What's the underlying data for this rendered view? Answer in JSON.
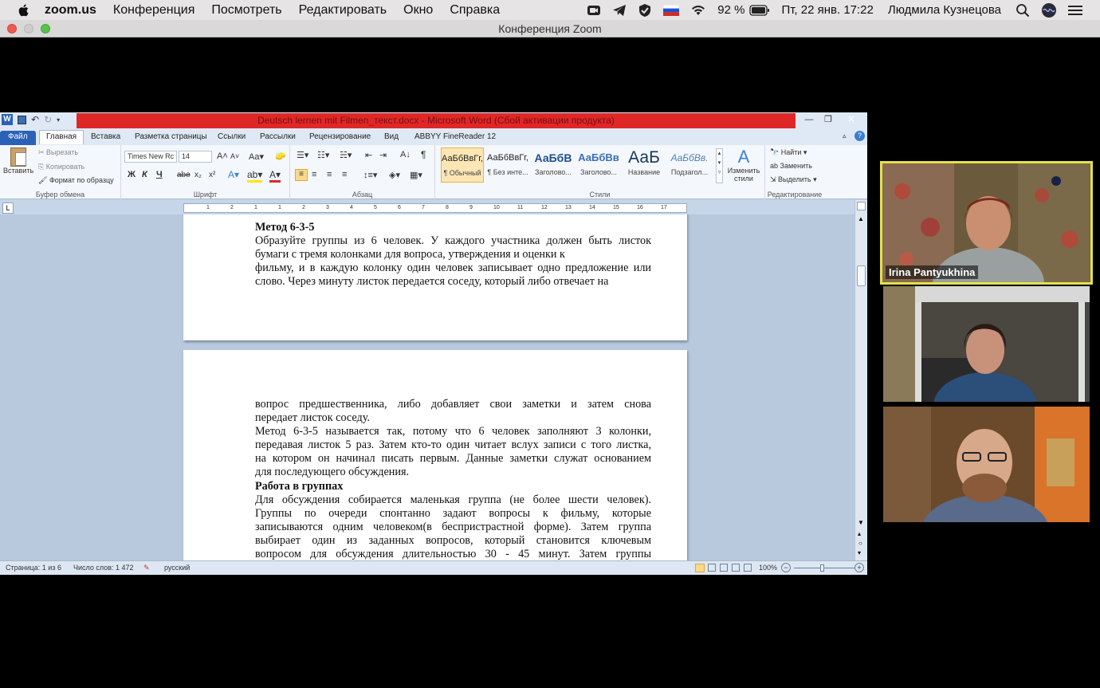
{
  "menubar": {
    "app": "zoom.us",
    "items": [
      "Конференция",
      "Посмотреть",
      "Редактировать",
      "Окно",
      "Справка"
    ],
    "battery": "92 %",
    "datetime": "Пт, 22 янв.  17:22",
    "user": "Людмила Кузнецова"
  },
  "zoom": {
    "window_title": "Конференция Zoom"
  },
  "word": {
    "title": "Deutsch lernen mit Filmen_текст.docx  -  Microsoft Word (Сбой активации продукта)",
    "tabs": [
      "Файл",
      "Главная",
      "Вставка",
      "Разметка страницы",
      "Ссылки",
      "Рассылки",
      "Рецензирование",
      "Вид",
      "ABBYY FineReader 12"
    ],
    "clipboard": {
      "paste": "Вставить",
      "cut": "Вырезать",
      "copy": "Копировать",
      "format_painter": "Формат по образцу",
      "label": "Буфер обмена"
    },
    "font": {
      "name": "Times New Rc",
      "size": "14",
      "bold": "Ж",
      "italic": "К",
      "underline": "Ч",
      "strike": "abe",
      "subscript": "x₂",
      "superscript": "x²",
      "label": "Шрифт"
    },
    "paragraph": {
      "label": "Абзац"
    },
    "styles": {
      "items": [
        {
          "preview": "АаБбВвГг,",
          "name": "¶ Обычный"
        },
        {
          "preview": "АаБбВвГг,",
          "name": "¶ Без инте..."
        },
        {
          "preview": "АаБбВ",
          "name": "Заголово..."
        },
        {
          "preview": "АаБбВв",
          "name": "Заголово..."
        },
        {
          "preview": "АаБ",
          "name": "Название"
        },
        {
          "preview": "АаБбВв.",
          "name": "Подзагол..."
        }
      ],
      "change": "Изменить стили",
      "label": "Стили"
    },
    "editing": {
      "find": "Найти",
      "replace": "Заменить",
      "select": "Выделить",
      "label": "Редактирование"
    },
    "ruler_numbers": [
      "1",
      "2",
      "1",
      "1",
      "2",
      "3",
      "4",
      "5",
      "6",
      "7",
      "8",
      "9",
      "10",
      "11",
      "12",
      "13",
      "14",
      "15",
      "16",
      "17"
    ],
    "page1": {
      "heading": "Метод 6-3-5",
      "lines": [
        "Образуйте группы из 6 человек. У каждого участника должен быть листок",
        "бумаги с тремя колонками для вопроса, утверждения и оценки к",
        "фильму, и в каждую колонку один человек записывает одно предложение или",
        "слово. Через минуту листок передается соседу, который либо отвечает на"
      ]
    },
    "page2": {
      "lines_a": [
        "вопрос предшественника, либо добавляет свои заметки и затем снова",
        "передает листок соседу.",
        "Метод 6-3-5 называется так, потому что 6 человек заполняют 3 колонки,",
        "передавая листок 5 раз. Затем кто-то один читает вслух записи с того листка,",
        "на котором он начинал писать первым. Данные заметки служат основанием",
        "для последующего обсуждения."
      ],
      "heading": "Работа в группах",
      "lines_b": [
        "Для обсуждения собирается маленькая группа (не более шести человек).",
        "Группы по очереди спонтанно задают вопросы к фильму, которые",
        "записываются одним человеком(в беспристрастной форме). Затем группа",
        "выбирает один из заданных вопросов, который становится ключевым",
        "вопросом для обсуждения длительностью 30 - 45 минут. Затем группы"
      ]
    },
    "status": {
      "page": "Страница: 1 из 6",
      "words": "Число слов: 1 472",
      "language": "русский",
      "zoom": "100%"
    }
  },
  "participants": [
    {
      "name": "Irina Pantyukhina",
      "active": true
    },
    {
      "name": "",
      "active": false
    },
    {
      "name": "",
      "active": false
    }
  ],
  "colors": {
    "word_title_red": "#e02727",
    "active_speaker": "#e3e14a",
    "file_tab": "#2b62b8"
  }
}
